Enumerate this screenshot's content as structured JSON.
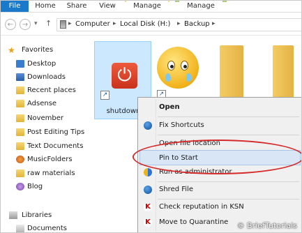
{
  "ribbon": {
    "file": "File",
    "tabs": [
      "Home",
      "Share",
      "View"
    ],
    "manage_1": "Manage",
    "manage_2": "Manage",
    "manage_1_color": "#f7e082",
    "manage_2_color": "#a9cf7a"
  },
  "address": {
    "crumbs": [
      "Computer",
      "Local Disk (H:)",
      "Backup"
    ]
  },
  "nav": {
    "favorites": "Favorites",
    "items": [
      {
        "label": "Desktop",
        "icon": "desktop-icon"
      },
      {
        "label": "Downloads",
        "icon": "downloads-icon"
      },
      {
        "label": "Recent places",
        "icon": "recent-places-icon"
      },
      {
        "label": "Adsense",
        "icon": "folder-icon"
      },
      {
        "label": "November",
        "icon": "folder-icon"
      },
      {
        "label": "Post Editing Tips",
        "icon": "folder-icon"
      },
      {
        "label": "Text Documents",
        "icon": "folder-icon"
      },
      {
        "label": "MusicFolders",
        "icon": "music-folder-icon"
      },
      {
        "label": "raw materials",
        "icon": "folder-icon"
      },
      {
        "label": "Blog",
        "icon": "blog-icon"
      }
    ],
    "libraries": "Libraries",
    "documents": "Documents"
  },
  "content": {
    "selected_item_label": "shutdown"
  },
  "context_menu": {
    "items": [
      {
        "label": "Open",
        "bold": true,
        "icon": ""
      },
      {
        "label": "Fix Shortcuts",
        "icon": "fix-shortcuts-icon"
      },
      {
        "label": "Open file location",
        "icon": ""
      },
      {
        "label": "Pin to Start",
        "icon": "",
        "highlighted": true
      },
      {
        "label": "Run as administrator",
        "icon": "uac-shield-icon"
      },
      {
        "label": "Shred File",
        "icon": "shred-file-icon"
      },
      {
        "label": "Check reputation in KSN",
        "icon": "kaspersky-icon"
      },
      {
        "label": "Move to Quarantine",
        "icon": "kaspersky-icon"
      }
    ]
  },
  "watermark": "© BriefTutorials",
  "colors": {
    "file_tab": "#1979ca",
    "selection": "#cce8ff",
    "annotation": "#d42a2a"
  }
}
